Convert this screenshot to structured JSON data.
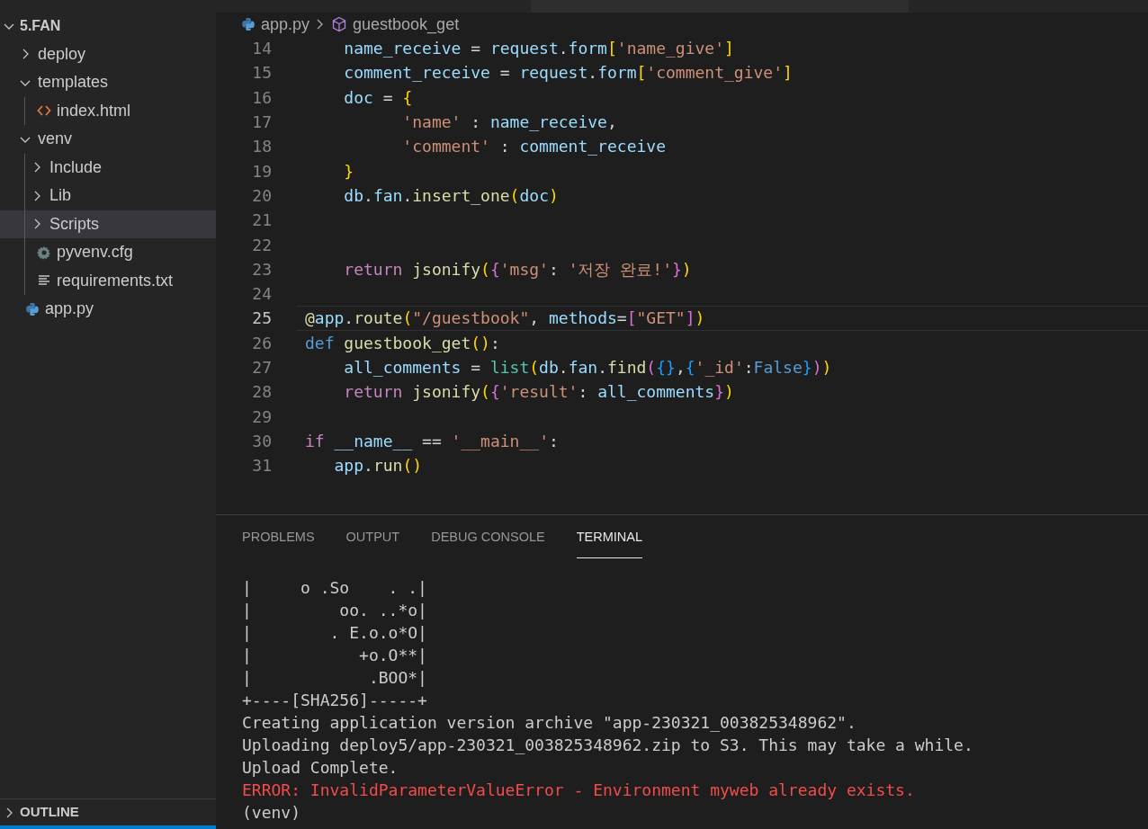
{
  "explorer": {
    "root": {
      "label": "5.FAN",
      "expanded": true,
      "children": [
        {
          "label": "deploy",
          "kind": "folder",
          "expanded": false,
          "selected": false
        },
        {
          "label": "templates",
          "kind": "folder",
          "expanded": true,
          "selected": false,
          "children": [
            {
              "label": "index.html",
              "kind": "html",
              "selected": false
            }
          ]
        },
        {
          "label": "venv",
          "kind": "folder",
          "expanded": true,
          "selected": false,
          "children": [
            {
              "label": "Include",
              "kind": "folder",
              "expanded": false,
              "selected": false
            },
            {
              "label": "Lib",
              "kind": "folder",
              "expanded": false,
              "selected": false
            },
            {
              "label": "Scripts",
              "kind": "folder",
              "expanded": false,
              "selected": true
            },
            {
              "label": "pyvenv.cfg",
              "kind": "config",
              "selected": false
            },
            {
              "label": "requirements.txt",
              "kind": "text",
              "selected": false
            }
          ]
        },
        {
          "label": "app.py",
          "kind": "python",
          "selected": false
        }
      ]
    },
    "outline": {
      "label": "OUTLINE",
      "expanded": false
    }
  },
  "breadcrumb": {
    "file": "app.py",
    "symbol": "guestbook_get"
  },
  "code": [
    {
      "number": "14",
      "current": false,
      "tokens": [
        {
          "kind": "var",
          "text": "    name_receive"
        },
        {
          "kind": "plain",
          "text": " = "
        },
        {
          "kind": "var",
          "text": "request"
        },
        {
          "kind": "plain",
          "text": "."
        },
        {
          "kind": "var",
          "text": "form"
        },
        {
          "kind": "brace1",
          "text": "["
        },
        {
          "kind": "string",
          "text": "'name_give'"
        },
        {
          "kind": "brace1",
          "text": "]"
        }
      ]
    },
    {
      "number": "15",
      "current": false,
      "tokens": [
        {
          "kind": "var",
          "text": "    comment_receive"
        },
        {
          "kind": "plain",
          "text": " = "
        },
        {
          "kind": "var",
          "text": "request"
        },
        {
          "kind": "plain",
          "text": "."
        },
        {
          "kind": "var",
          "text": "form"
        },
        {
          "kind": "brace1",
          "text": "["
        },
        {
          "kind": "string",
          "text": "'comment_give'"
        },
        {
          "kind": "brace1",
          "text": "]"
        }
      ]
    },
    {
      "number": "16",
      "current": false,
      "tokens": [
        {
          "kind": "var",
          "text": "    doc"
        },
        {
          "kind": "plain",
          "text": " = "
        },
        {
          "kind": "brace1",
          "text": "{"
        }
      ]
    },
    {
      "number": "17",
      "current": false,
      "tokens": [
        {
          "kind": "string",
          "text": "          'name'"
        },
        {
          "kind": "plain",
          "text": " : "
        },
        {
          "kind": "var",
          "text": "name_receive"
        },
        {
          "kind": "plain",
          "text": ","
        }
      ]
    },
    {
      "number": "18",
      "current": false,
      "tokens": [
        {
          "kind": "string",
          "text": "          'comment'"
        },
        {
          "kind": "plain",
          "text": " : "
        },
        {
          "kind": "var",
          "text": "comment_receive"
        }
      ]
    },
    {
      "number": "19",
      "current": false,
      "tokens": [
        {
          "kind": "brace1",
          "text": "    }"
        }
      ]
    },
    {
      "number": "20",
      "current": false,
      "tokens": [
        {
          "kind": "var",
          "text": "    db"
        },
        {
          "kind": "plain",
          "text": "."
        },
        {
          "kind": "var",
          "text": "fan"
        },
        {
          "kind": "plain",
          "text": "."
        },
        {
          "kind": "func",
          "text": "insert_one"
        },
        {
          "kind": "brace1",
          "text": "("
        },
        {
          "kind": "var",
          "text": "doc"
        },
        {
          "kind": "brace1",
          "text": ")"
        }
      ]
    },
    {
      "number": "21",
      "current": false
    },
    {
      "number": "22",
      "current": false
    },
    {
      "number": "23",
      "current": false,
      "tokens": [
        {
          "kind": "keyword",
          "text": "    return"
        },
        {
          "kind": "func",
          "text": " jsonify"
        },
        {
          "kind": "brace1",
          "text": "("
        },
        {
          "kind": "brace2",
          "text": "{"
        },
        {
          "kind": "string",
          "text": "'msg'"
        },
        {
          "kind": "plain",
          "text": ": "
        },
        {
          "kind": "string",
          "text": "'저장 완료!'"
        },
        {
          "kind": "brace2",
          "text": "}"
        },
        {
          "kind": "brace1",
          "text": ")"
        }
      ]
    },
    {
      "number": "24",
      "current": false
    },
    {
      "number": "25",
      "current": true,
      "tokens": [
        {
          "kind": "func",
          "text": "@"
        },
        {
          "kind": "var",
          "text": "app"
        },
        {
          "kind": "plain",
          "text": "."
        },
        {
          "kind": "func",
          "text": "route"
        },
        {
          "kind": "brace1",
          "text": "("
        },
        {
          "kind": "string",
          "text": "\"/guestbook\""
        },
        {
          "kind": "plain",
          "text": ", "
        },
        {
          "kind": "var",
          "text": "methods"
        },
        {
          "kind": "plain",
          "text": "="
        },
        {
          "kind": "brace2",
          "text": "["
        },
        {
          "kind": "string",
          "text": "\"GET\""
        },
        {
          "kind": "brace2",
          "text": "]"
        },
        {
          "kind": "brace1",
          "text": ")"
        }
      ]
    },
    {
      "number": "26",
      "current": false,
      "tokens": [
        {
          "kind": "storage",
          "text": "def"
        },
        {
          "kind": "func",
          "text": " guestbook_get"
        },
        {
          "kind": "brace1",
          "text": "()"
        },
        {
          "kind": "plain",
          "text": ":"
        }
      ]
    },
    {
      "number": "27",
      "current": false,
      "tokens": [
        {
          "kind": "var",
          "text": "    all_comments"
        },
        {
          "kind": "plain",
          "text": " = "
        },
        {
          "kind": "builtin",
          "text": "list"
        },
        {
          "kind": "brace1",
          "text": "("
        },
        {
          "kind": "var",
          "text": "db"
        },
        {
          "kind": "plain",
          "text": "."
        },
        {
          "kind": "var",
          "text": "fan"
        },
        {
          "kind": "plain",
          "text": "."
        },
        {
          "kind": "func",
          "text": "find"
        },
        {
          "kind": "brace2",
          "text": "("
        },
        {
          "kind": "brace3",
          "text": "{}"
        },
        {
          "kind": "plain",
          "text": ","
        },
        {
          "kind": "brace3",
          "text": "{"
        },
        {
          "kind": "string",
          "text": "'_id'"
        },
        {
          "kind": "plain",
          "text": ":"
        },
        {
          "kind": "storage",
          "text": "False"
        },
        {
          "kind": "brace3",
          "text": "}"
        },
        {
          "kind": "brace2",
          "text": ")"
        },
        {
          "kind": "brace1",
          "text": ")"
        }
      ]
    },
    {
      "number": "28",
      "current": false,
      "tokens": [
        {
          "kind": "keyword",
          "text": "    return"
        },
        {
          "kind": "func",
          "text": " jsonify"
        },
        {
          "kind": "brace1",
          "text": "("
        },
        {
          "kind": "brace2",
          "text": "{"
        },
        {
          "kind": "string",
          "text": "'result'"
        },
        {
          "kind": "plain",
          "text": ": "
        },
        {
          "kind": "var",
          "text": "all_comments"
        },
        {
          "kind": "brace2",
          "text": "}"
        },
        {
          "kind": "brace1",
          "text": ")"
        }
      ]
    },
    {
      "number": "29",
      "current": false
    },
    {
      "number": "30",
      "current": false,
      "tokens": [
        {
          "kind": "keyword",
          "text": "if"
        },
        {
          "kind": "var",
          "text": " __name__"
        },
        {
          "kind": "plain",
          "text": " == "
        },
        {
          "kind": "string",
          "text": "'__main__'"
        },
        {
          "kind": "plain",
          "text": ":"
        }
      ]
    },
    {
      "number": "31",
      "current": false,
      "tokens": [
        {
          "kind": "var",
          "text": "   app"
        },
        {
          "kind": "plain",
          "text": "."
        },
        {
          "kind": "func",
          "text": "run"
        },
        {
          "kind": "brace1",
          "text": "()"
        }
      ]
    }
  ],
  "panel": {
    "tabs": [
      {
        "label": "PROBLEMS",
        "selected": false
      },
      {
        "label": "OUTPUT",
        "selected": false
      },
      {
        "label": "DEBUG CONSOLE",
        "selected": false
      },
      {
        "label": "TERMINAL",
        "selected": true
      }
    ],
    "terminal": [
      {
        "kind": "normal",
        "text": "|     o .So    . .|"
      },
      {
        "kind": "normal",
        "text": "|         oo. ..*o|"
      },
      {
        "kind": "normal",
        "text": "|        . E.o.o*O|"
      },
      {
        "kind": "normal",
        "text": "|           +o.O**|"
      },
      {
        "kind": "normal",
        "text": "|            .BOO*|"
      },
      {
        "kind": "normal",
        "text": "+----[SHA256]-----+"
      },
      {
        "kind": "normal",
        "text": "Creating application version archive \"app-230321_003825348962\"."
      },
      {
        "kind": "normal",
        "text": "Uploading deploy5/app-230321_003825348962.zip to S3. This may take a while."
      },
      {
        "kind": "normal",
        "text": "Upload Complete."
      },
      {
        "kind": "error",
        "text": "ERROR: InvalidParameterValueError - Environment myweb already exists."
      },
      {
        "kind": "normal",
        "text": "(venv)"
      }
    ]
  }
}
